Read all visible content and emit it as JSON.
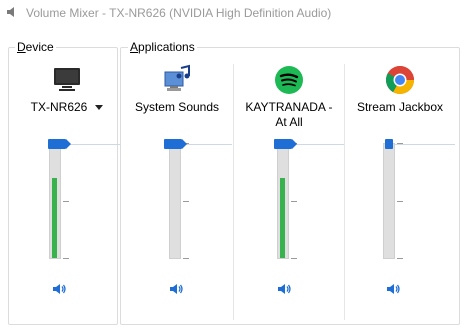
{
  "window": {
    "title": "Volume Mixer - TX-NR626 (NVIDIA High Definition Audio)"
  },
  "device_section": {
    "label_first": "D",
    "label_rest": "evice"
  },
  "applications_section": {
    "label_first": "A",
    "label_rest": "pplications"
  },
  "device": {
    "name": "TX-NR626",
    "icon": "monitor-icon",
    "volume_percent": 100,
    "meter_level_percent": 70
  },
  "apps": [
    {
      "name": "System Sounds",
      "icon": "system-sounds-icon",
      "volume_percent": 100,
      "meter_level_percent": 0
    },
    {
      "name": "KAYTRANADA -\nAt All",
      "icon": "spotify-icon",
      "volume_percent": 100,
      "meter_level_percent": 70
    },
    {
      "name": "Stream Jackbox",
      "icon": "chrome-icon",
      "volume_percent": 100,
      "meter_level_percent": 0
    }
  ],
  "colors": {
    "accent": "#1e6ed6",
    "meter": "#37b24d",
    "spotify": "#1db954"
  }
}
